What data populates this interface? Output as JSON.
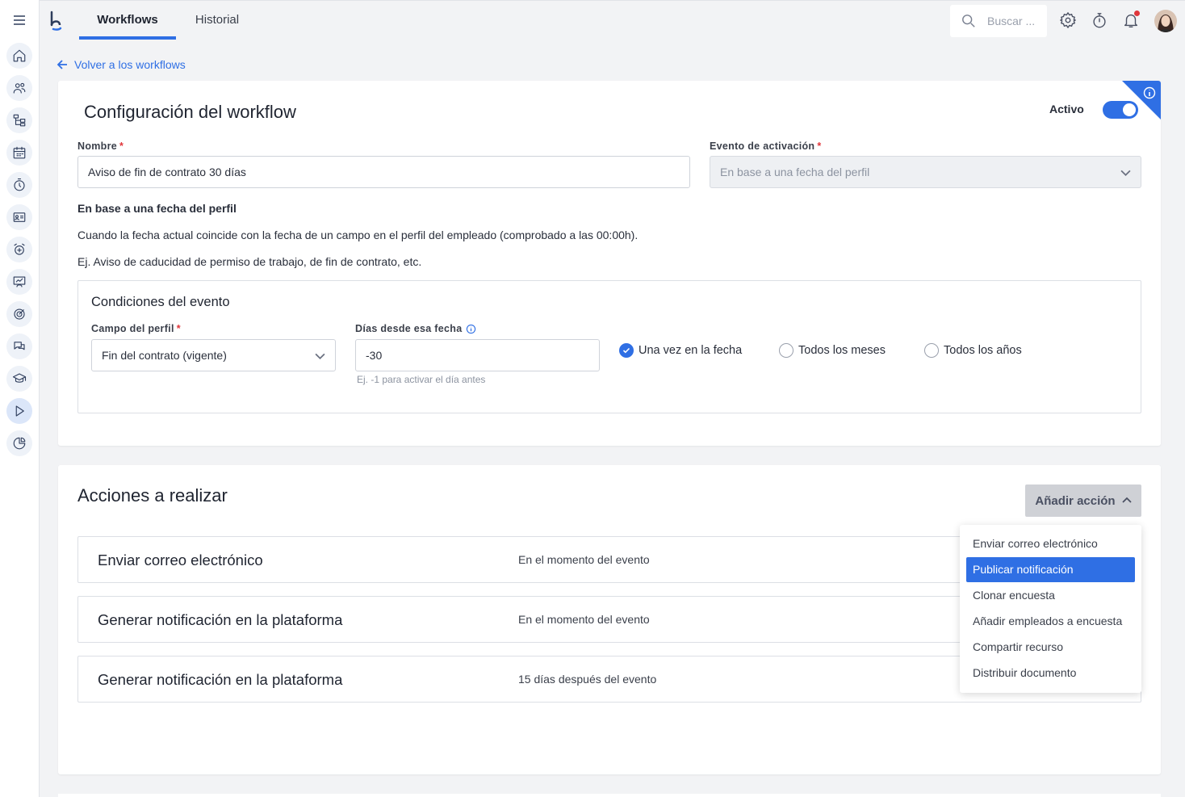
{
  "colors": {
    "accent": "#2f6fe4",
    "required": "#e0363b",
    "notification_dot": "#e0363b"
  },
  "sidebar": {
    "menu_icon": "hamburger-icon",
    "items": [
      {
        "icon": "home-icon"
      },
      {
        "icon": "people-icon"
      },
      {
        "icon": "org-chart-icon"
      },
      {
        "icon": "calendar-icon"
      },
      {
        "icon": "stopwatch-icon"
      },
      {
        "icon": "id-card-icon"
      },
      {
        "icon": "alarm-icon"
      },
      {
        "icon": "performance-icon"
      },
      {
        "icon": "target-icon"
      },
      {
        "icon": "chat-icon"
      },
      {
        "icon": "graduation-cap-icon"
      },
      {
        "icon": "play-icon",
        "active": true
      },
      {
        "icon": "pie-chart-icon"
      }
    ]
  },
  "header": {
    "tabs": [
      {
        "label": "Workflows",
        "active": true
      },
      {
        "label": "Historial",
        "active": false
      }
    ],
    "search_placeholder": "Buscar ..."
  },
  "back_link": "Volver a los workflows",
  "config": {
    "title": "Configuración del workflow",
    "active_label": "Activo",
    "active": true,
    "name_label": "Nombre",
    "name_value": "Aviso de fin de contrato 30 días",
    "trigger_label": "Evento de activación",
    "trigger_value": "En base a una fecha del perfil",
    "required_mark": "*",
    "trigger_desc_title": "En base a una fecha del perfil",
    "trigger_desc": "Cuando la fecha actual coincide con la fecha de un campo en el perfil del empleado (comprobado a las 00:00h).",
    "trigger_example": "Ej. Aviso de caducidad de permiso de trabajo, de fin de contrato, etc.",
    "conditions": {
      "title": "Condiciones del evento",
      "profile_field_label": "Campo del perfil",
      "profile_field_value": "Fin del contrato (vigente)",
      "days_label": "Días desde esa fecha",
      "days_value": "-30",
      "days_hint": "Ej. -1 para activar el día antes",
      "recurrence": [
        {
          "label": "Una vez en la fecha",
          "checked": true
        },
        {
          "label": "Todos los meses",
          "checked": false
        },
        {
          "label": "Todos los años",
          "checked": false
        }
      ]
    }
  },
  "actions": {
    "title": "Acciones a realizar",
    "add_button": "Añadir acción",
    "rows": [
      {
        "name": "Enviar correo electrónico",
        "when": "En el momento del evento"
      },
      {
        "name": "Generar notificación en la plataforma",
        "when": "En el momento del evento"
      },
      {
        "name": "Generar notificación en la plataforma",
        "when": "15 días después del evento"
      }
    ],
    "menu": [
      {
        "label": "Enviar correo electrónico",
        "selected": false
      },
      {
        "label": "Publicar notificación",
        "selected": true
      },
      {
        "label": "Clonar encuesta",
        "selected": false
      },
      {
        "label": "Añadir empleados a encuesta",
        "selected": false
      },
      {
        "label": "Compartir recurso",
        "selected": false
      },
      {
        "label": "Distribuir documento",
        "selected": false
      }
    ]
  }
}
